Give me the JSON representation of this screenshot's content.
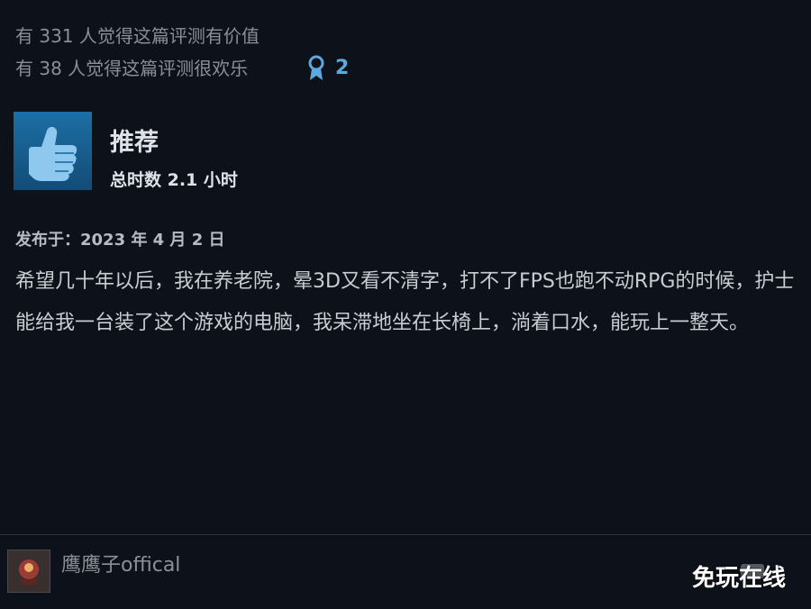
{
  "votes": {
    "helpful": "有 331 人觉得这篇评测有价值",
    "funny": "有 38 人觉得这篇评测很欢乐",
    "award_count": "2"
  },
  "review": {
    "recommendation": "推荐",
    "playtime": "总时数 2.1 小时",
    "posted": "发布于：2023 年 4 月 2 日",
    "body": "希望几十年以后，我在养老院，晕3D又看不清字，打不了FPS也跑不动RPG的时候，护士能给我一台装了这个游戏的电脑，我呆滞地坐在长椅上，淌着口水，能玩上一整天。"
  },
  "author": {
    "name": "鹰鹰子offical"
  },
  "watermark": "免玩在线",
  "colors": {
    "background": "#0d121a",
    "thumb_box": "#1c6fa4",
    "award": "#5ca9df"
  },
  "icons": {
    "thumb": "thumbs-up-icon",
    "award": "award-ribbon-icon"
  }
}
